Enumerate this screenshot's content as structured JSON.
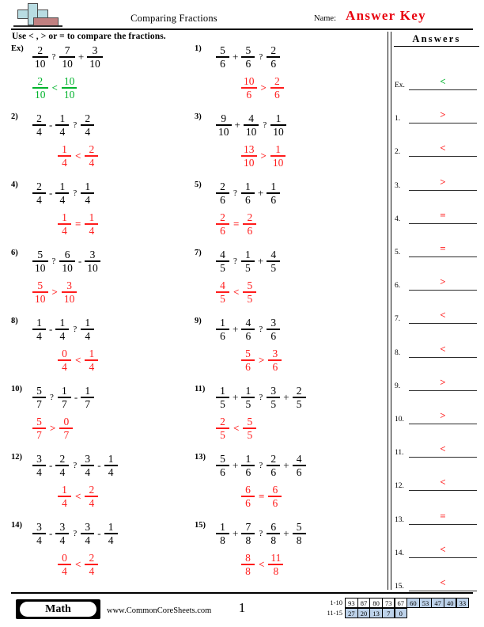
{
  "header": {
    "title": "Comparing Fractions",
    "name_label": "Name:",
    "answer_key": "Answer Key",
    "logo_icon": "plus-block-icon"
  },
  "instruction": "Use < , > or = to compare the fractions.",
  "answers_panel": {
    "title": "Answers",
    "rows": [
      {
        "label": "Ex.",
        "value": "<",
        "color": "green"
      },
      {
        "label": "1.",
        "value": ">",
        "color": "red"
      },
      {
        "label": "2.",
        "value": "<",
        "color": "red"
      },
      {
        "label": "3.",
        "value": ">",
        "color": "red"
      },
      {
        "label": "4.",
        "value": "=",
        "color": "red"
      },
      {
        "label": "5.",
        "value": "=",
        "color": "red"
      },
      {
        "label": "6.",
        "value": ">",
        "color": "red"
      },
      {
        "label": "7.",
        "value": "<",
        "color": "red"
      },
      {
        "label": "8.",
        "value": "<",
        "color": "red"
      },
      {
        "label": "9.",
        "value": ">",
        "color": "red"
      },
      {
        "label": "10.",
        "value": ">",
        "color": "red"
      },
      {
        "label": "11.",
        "value": "<",
        "color": "red"
      },
      {
        "label": "12.",
        "value": "<",
        "color": "red"
      },
      {
        "label": "13.",
        "value": "=",
        "color": "red"
      },
      {
        "label": "14.",
        "value": "<",
        "color": "red"
      },
      {
        "label": "15.",
        "value": "<",
        "color": "red"
      }
    ]
  },
  "problems": [
    {
      "num": "Ex)",
      "col": 0,
      "row": 0,
      "answer_color": "green",
      "question": [
        {
          "t": "frac",
          "n": "2",
          "d": "10"
        },
        {
          "t": "q",
          "v": "?"
        },
        {
          "t": "frac",
          "n": "7",
          "d": "10"
        },
        {
          "t": "op",
          "v": "+"
        },
        {
          "t": "frac",
          "n": "3",
          "d": "10"
        }
      ],
      "answer": [
        {
          "t": "frac",
          "n": "2",
          "d": "10"
        },
        {
          "t": "cmp",
          "v": "<"
        },
        {
          "t": "frac",
          "n": "10",
          "d": "10"
        }
      ],
      "answer_indent": 26
    },
    {
      "num": "1)",
      "col": 1,
      "row": 0,
      "answer_color": "red",
      "question": [
        {
          "t": "frac",
          "n": "5",
          "d": "6"
        },
        {
          "t": "op",
          "v": "+"
        },
        {
          "t": "frac",
          "n": "5",
          "d": "6"
        },
        {
          "t": "q",
          "v": "?"
        },
        {
          "t": "frac",
          "n": "2",
          "d": "6"
        }
      ],
      "answer": [
        {
          "t": "frac",
          "n": "10",
          "d": "6"
        },
        {
          "t": "cmp",
          "v": ">"
        },
        {
          "t": "frac",
          "n": "2",
          "d": "6"
        }
      ],
      "answer_indent": 58
    },
    {
      "num": "2)",
      "col": 0,
      "row": 1,
      "answer_color": "red",
      "question": [
        {
          "t": "frac",
          "n": "2",
          "d": "4"
        },
        {
          "t": "op",
          "v": "-"
        },
        {
          "t": "frac",
          "n": "1",
          "d": "4"
        },
        {
          "t": "q",
          "v": "?"
        },
        {
          "t": "frac",
          "n": "2",
          "d": "4"
        }
      ],
      "answer": [
        {
          "t": "frac",
          "n": "1",
          "d": "4"
        },
        {
          "t": "cmp",
          "v": "<"
        },
        {
          "t": "frac",
          "n": "2",
          "d": "4"
        }
      ],
      "answer_indent": 58
    },
    {
      "num": "3)",
      "col": 1,
      "row": 1,
      "answer_color": "red",
      "question": [
        {
          "t": "frac",
          "n": "9",
          "d": "10"
        },
        {
          "t": "op",
          "v": "+"
        },
        {
          "t": "frac",
          "n": "4",
          "d": "10"
        },
        {
          "t": "q",
          "v": "?"
        },
        {
          "t": "frac",
          "n": "1",
          "d": "10"
        }
      ],
      "answer": [
        {
          "t": "frac",
          "n": "13",
          "d": "10"
        },
        {
          "t": "cmp",
          "v": ">"
        },
        {
          "t": "frac",
          "n": "1",
          "d": "10"
        }
      ],
      "answer_indent": 58
    },
    {
      "num": "4)",
      "col": 0,
      "row": 2,
      "answer_color": "red",
      "question": [
        {
          "t": "frac",
          "n": "2",
          "d": "4"
        },
        {
          "t": "op",
          "v": "-"
        },
        {
          "t": "frac",
          "n": "1",
          "d": "4"
        },
        {
          "t": "q",
          "v": "?"
        },
        {
          "t": "frac",
          "n": "1",
          "d": "4"
        }
      ],
      "answer": [
        {
          "t": "frac",
          "n": "1",
          "d": "4"
        },
        {
          "t": "cmp",
          "v": "="
        },
        {
          "t": "frac",
          "n": "1",
          "d": "4"
        }
      ],
      "answer_indent": 58
    },
    {
      "num": "5)",
      "col": 1,
      "row": 2,
      "answer_color": "red",
      "question": [
        {
          "t": "frac",
          "n": "2",
          "d": "6"
        },
        {
          "t": "q",
          "v": "?"
        },
        {
          "t": "frac",
          "n": "1",
          "d": "6"
        },
        {
          "t": "op",
          "v": "+"
        },
        {
          "t": "frac",
          "n": "1",
          "d": "6"
        }
      ],
      "answer": [
        {
          "t": "frac",
          "n": "2",
          "d": "6"
        },
        {
          "t": "cmp",
          "v": "="
        },
        {
          "t": "frac",
          "n": "2",
          "d": "6"
        }
      ],
      "answer_indent": 26
    },
    {
      "num": "6)",
      "col": 0,
      "row": 3,
      "answer_color": "red",
      "question": [
        {
          "t": "frac",
          "n": "5",
          "d": "10"
        },
        {
          "t": "q",
          "v": "?"
        },
        {
          "t": "frac",
          "n": "6",
          "d": "10"
        },
        {
          "t": "op",
          "v": "-"
        },
        {
          "t": "frac",
          "n": "3",
          "d": "10"
        }
      ],
      "answer": [
        {
          "t": "frac",
          "n": "5",
          "d": "10"
        },
        {
          "t": "cmp",
          "v": ">"
        },
        {
          "t": "frac",
          "n": "3",
          "d": "10"
        }
      ],
      "answer_indent": 26
    },
    {
      "num": "7)",
      "col": 1,
      "row": 3,
      "answer_color": "red",
      "question": [
        {
          "t": "frac",
          "n": "4",
          "d": "5"
        },
        {
          "t": "q",
          "v": "?"
        },
        {
          "t": "frac",
          "n": "1",
          "d": "5"
        },
        {
          "t": "op",
          "v": "+"
        },
        {
          "t": "frac",
          "n": "4",
          "d": "5"
        }
      ],
      "answer": [
        {
          "t": "frac",
          "n": "4",
          "d": "5"
        },
        {
          "t": "cmp",
          "v": "<"
        },
        {
          "t": "frac",
          "n": "5",
          "d": "5"
        }
      ],
      "answer_indent": 26
    },
    {
      "num": "8)",
      "col": 0,
      "row": 4,
      "answer_color": "red",
      "question": [
        {
          "t": "frac",
          "n": "1",
          "d": "4"
        },
        {
          "t": "op",
          "v": "-"
        },
        {
          "t": "frac",
          "n": "1",
          "d": "4"
        },
        {
          "t": "q",
          "v": "?"
        },
        {
          "t": "frac",
          "n": "1",
          "d": "4"
        }
      ],
      "answer": [
        {
          "t": "frac",
          "n": "0",
          "d": "4"
        },
        {
          "t": "cmp",
          "v": "<"
        },
        {
          "t": "frac",
          "n": "1",
          "d": "4"
        }
      ],
      "answer_indent": 58
    },
    {
      "num": "9)",
      "col": 1,
      "row": 4,
      "answer_color": "red",
      "question": [
        {
          "t": "frac",
          "n": "1",
          "d": "6"
        },
        {
          "t": "op",
          "v": "+"
        },
        {
          "t": "frac",
          "n": "4",
          "d": "6"
        },
        {
          "t": "q",
          "v": "?"
        },
        {
          "t": "frac",
          "n": "3",
          "d": "6"
        }
      ],
      "answer": [
        {
          "t": "frac",
          "n": "5",
          "d": "6"
        },
        {
          "t": "cmp",
          "v": ">"
        },
        {
          "t": "frac",
          "n": "3",
          "d": "6"
        }
      ],
      "answer_indent": 58
    },
    {
      "num": "10)",
      "col": 0,
      "row": 5,
      "answer_color": "red",
      "question": [
        {
          "t": "frac",
          "n": "5",
          "d": "7"
        },
        {
          "t": "q",
          "v": "?"
        },
        {
          "t": "frac",
          "n": "1",
          "d": "7"
        },
        {
          "t": "op",
          "v": "-"
        },
        {
          "t": "frac",
          "n": "1",
          "d": "7"
        }
      ],
      "answer": [
        {
          "t": "frac",
          "n": "5",
          "d": "7"
        },
        {
          "t": "cmp",
          "v": ">"
        },
        {
          "t": "frac",
          "n": "0",
          "d": "7"
        }
      ],
      "answer_indent": 26
    },
    {
      "num": "11)",
      "col": 1,
      "row": 5,
      "answer_color": "red",
      "question": [
        {
          "t": "frac",
          "n": "1",
          "d": "5"
        },
        {
          "t": "op",
          "v": "+"
        },
        {
          "t": "frac",
          "n": "1",
          "d": "5"
        },
        {
          "t": "q",
          "v": "?"
        },
        {
          "t": "frac",
          "n": "3",
          "d": "5"
        },
        {
          "t": "op",
          "v": "+"
        },
        {
          "t": "frac",
          "n": "2",
          "d": "5"
        }
      ],
      "answer": [
        {
          "t": "frac",
          "n": "2",
          "d": "5"
        },
        {
          "t": "cmp",
          "v": "<"
        },
        {
          "t": "frac",
          "n": "5",
          "d": "5"
        }
      ],
      "answer_indent": 26
    },
    {
      "num": "12)",
      "col": 0,
      "row": 6,
      "answer_color": "red",
      "question": [
        {
          "t": "frac",
          "n": "3",
          "d": "4"
        },
        {
          "t": "op",
          "v": "-"
        },
        {
          "t": "frac",
          "n": "2",
          "d": "4"
        },
        {
          "t": "q",
          "v": "?"
        },
        {
          "t": "frac",
          "n": "3",
          "d": "4"
        },
        {
          "t": "op",
          "v": "-"
        },
        {
          "t": "frac",
          "n": "1",
          "d": "4"
        }
      ],
      "answer": [
        {
          "t": "frac",
          "n": "1",
          "d": "4"
        },
        {
          "t": "cmp",
          "v": "<"
        },
        {
          "t": "frac",
          "n": "2",
          "d": "4"
        }
      ],
      "answer_indent": 58
    },
    {
      "num": "13)",
      "col": 1,
      "row": 6,
      "answer_color": "red",
      "question": [
        {
          "t": "frac",
          "n": "5",
          "d": "6"
        },
        {
          "t": "op",
          "v": "+"
        },
        {
          "t": "frac",
          "n": "1",
          "d": "6"
        },
        {
          "t": "q",
          "v": "?"
        },
        {
          "t": "frac",
          "n": "2",
          "d": "6"
        },
        {
          "t": "op",
          "v": "+"
        },
        {
          "t": "frac",
          "n": "4",
          "d": "6"
        }
      ],
      "answer": [
        {
          "t": "frac",
          "n": "6",
          "d": "6"
        },
        {
          "t": "cmp",
          "v": "="
        },
        {
          "t": "frac",
          "n": "6",
          "d": "6"
        }
      ],
      "answer_indent": 58
    },
    {
      "num": "14)",
      "col": 0,
      "row": 7,
      "answer_color": "red",
      "question": [
        {
          "t": "frac",
          "n": "3",
          "d": "4"
        },
        {
          "t": "op",
          "v": "-"
        },
        {
          "t": "frac",
          "n": "3",
          "d": "4"
        },
        {
          "t": "q",
          "v": "?"
        },
        {
          "t": "frac",
          "n": "3",
          "d": "4"
        },
        {
          "t": "op",
          "v": "-"
        },
        {
          "t": "frac",
          "n": "1",
          "d": "4"
        }
      ],
      "answer": [
        {
          "t": "frac",
          "n": "0",
          "d": "4"
        },
        {
          "t": "cmp",
          "v": "<"
        },
        {
          "t": "frac",
          "n": "2",
          "d": "4"
        }
      ],
      "answer_indent": 58
    },
    {
      "num": "15)",
      "col": 1,
      "row": 7,
      "answer_color": "red",
      "question": [
        {
          "t": "frac",
          "n": "1",
          "d": "8"
        },
        {
          "t": "op",
          "v": "+"
        },
        {
          "t": "frac",
          "n": "7",
          "d": "8"
        },
        {
          "t": "q",
          "v": "?"
        },
        {
          "t": "frac",
          "n": "6",
          "d": "8"
        },
        {
          "t": "op",
          "v": "+"
        },
        {
          "t": "frac",
          "n": "5",
          "d": "8"
        }
      ],
      "answer": [
        {
          "t": "frac",
          "n": "8",
          "d": "8"
        },
        {
          "t": "cmp",
          "v": "<"
        },
        {
          "t": "frac",
          "n": "11",
          "d": "8"
        }
      ],
      "answer_indent": 58
    }
  ],
  "footer": {
    "subject_badge": "Math",
    "website": "www.CommonCoreSheets.com",
    "page_number": "1",
    "score_table": {
      "rows": [
        {
          "label": "1-10",
          "cells": [
            {
              "v": "93",
              "highlight": false
            },
            {
              "v": "87",
              "highlight": false
            },
            {
              "v": "80",
              "highlight": false
            },
            {
              "v": "73",
              "highlight": false
            },
            {
              "v": "67",
              "highlight": false
            },
            {
              "v": "60",
              "highlight": true
            },
            {
              "v": "53",
              "highlight": true
            },
            {
              "v": "47",
              "highlight": true
            },
            {
              "v": "40",
              "highlight": true
            },
            {
              "v": "33",
              "highlight": true
            }
          ]
        },
        {
          "label": "11-15",
          "cells": [
            {
              "v": "27",
              "highlight": true
            },
            {
              "v": "20",
              "highlight": true
            },
            {
              "v": "13",
              "highlight": true
            },
            {
              "v": "7",
              "highlight": true
            },
            {
              "v": "0",
              "highlight": true
            }
          ]
        }
      ]
    }
  },
  "colors": {
    "answer_red": "#ff1c1c",
    "example_green": "#00b32c",
    "answer_key_red": "#e8000d",
    "score_highlight": "#bdd2ea"
  }
}
